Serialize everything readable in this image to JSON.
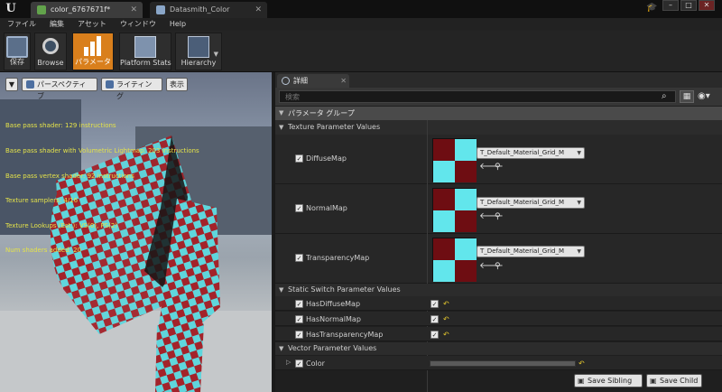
{
  "titlebar": {
    "tabs": [
      {
        "label": "color_6767671f*"
      },
      {
        "label": "Datasmith_Color"
      }
    ],
    "window_controls": {
      "minimize": "–",
      "maximize": "□",
      "close": "✕"
    }
  },
  "menu": [
    "ファイル",
    "編集",
    "アセット",
    "ウィンドウ",
    "Help"
  ],
  "toolbar": {
    "buttons": [
      {
        "label": "保存",
        "icon": "save-icon"
      },
      {
        "label": "Browse",
        "icon": "browse-icon"
      },
      {
        "label": "パラメータ",
        "icon": "parameters-icon",
        "active": true
      },
      {
        "label": "Platform Stats",
        "icon": "platform-stats-icon"
      },
      {
        "label": "Hierarchy",
        "icon": "hierarchy-icon"
      }
    ]
  },
  "viewport": {
    "perspective_label": "パースペクティブ",
    "lighting_label": "ライティング",
    "show_label": "表示",
    "stats": [
      "Base pass shader: 129 instructions",
      "Base pass shader with Volumetric Lightmap: 203 instructions",
      "Base pass vertex shader: 92 instructions",
      "Texture samplers: 4/16",
      "Texture Lookups (Est.): VS(0), PS(2)",
      "Num shaders added: 20"
    ]
  },
  "details": {
    "tab_label": "詳細",
    "search_placeholder": "検索",
    "category": "パラメータ グループ",
    "texture_section": "Texture Parameter Values",
    "texture_params": [
      {
        "name": "DiffuseMap",
        "value": "T_Default_Material_Grid_M"
      },
      {
        "name": "NormalMap",
        "value": "T_Default_Material_Grid_M"
      },
      {
        "name": "TransparencyMap",
        "value": "T_Default_Material_Grid_M"
      }
    ],
    "switch_section": "Static Switch Parameter Values",
    "switch_params": [
      {
        "name": "HasDiffuseMap",
        "checked": true
      },
      {
        "name": "HasNormalMap",
        "checked": true
      },
      {
        "name": "HasTransparencyMap",
        "checked": true
      }
    ],
    "vector_section": "Vector Parameter Values",
    "vector_params": [
      {
        "name": "Color"
      }
    ],
    "save_sibling": "Save Sibling",
    "save_child": "Save Child"
  },
  "colors": {
    "accent_orange": "#d97f1c",
    "checker_cyan": "#62e6ec",
    "checker_red": "#6e0d12",
    "reset_yellow": "#e6c92e",
    "stats_yellow": "#e4e24a"
  }
}
